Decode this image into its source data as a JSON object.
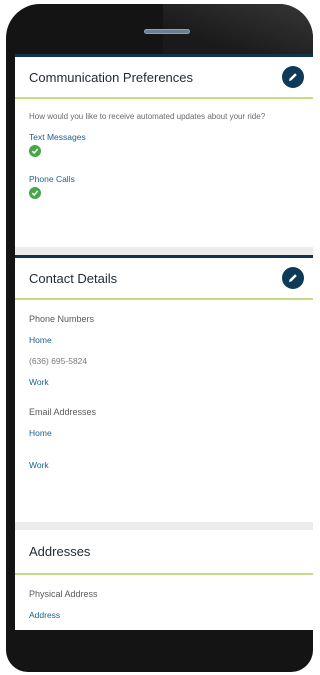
{
  "communication": {
    "title": "Communication Preferences",
    "prompt": "How would you like to receive automated updates about your ride?",
    "options": [
      {
        "label": "Text Messages",
        "enabled": true
      },
      {
        "label": "Phone Calls",
        "enabled": true
      }
    ]
  },
  "contact": {
    "title": "Contact Details",
    "phone_heading": "Phone Numbers",
    "phones": [
      {
        "type": "Home",
        "number": "(636) 695-5824"
      },
      {
        "type": "Work",
        "number": ""
      }
    ],
    "email_heading": "Email Addresses",
    "emails": [
      {
        "type": "Home",
        "address": ""
      },
      {
        "type": "Work",
        "address": ""
      }
    ]
  },
  "addresses": {
    "title": "Addresses",
    "physical_heading": "Physical Address",
    "address_link": "Address"
  },
  "colors": {
    "accent_navy": "#0f3a57",
    "divider_green": "#c6dc84",
    "link_blue": "#1d5f8e",
    "check_green": "#48a64a"
  },
  "icons": {
    "edit": "pencil-icon",
    "check": "check-circle-icon"
  }
}
